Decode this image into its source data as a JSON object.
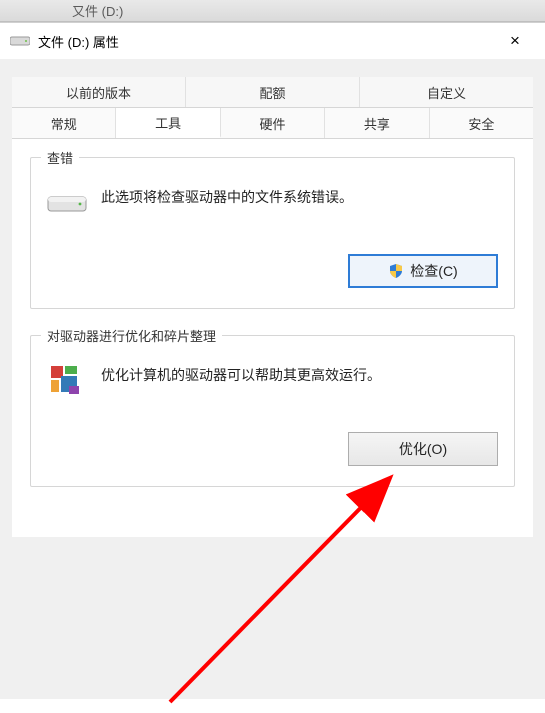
{
  "top_bar": {
    "label": "又件 (D:)"
  },
  "window": {
    "title": "文件 (D:) 属性",
    "close": "×"
  },
  "tabs": {
    "row1": [
      {
        "label": "以前的版本"
      },
      {
        "label": "配额"
      },
      {
        "label": "自定义"
      }
    ],
    "row2": [
      {
        "label": "常规"
      },
      {
        "label": "工具",
        "active": true
      },
      {
        "label": "硬件"
      },
      {
        "label": "共享"
      },
      {
        "label": "安全"
      }
    ]
  },
  "group_check": {
    "title": "查错",
    "desc": "此选项将检查驱动器中的文件系统错误。",
    "button": "检查(C)"
  },
  "group_defrag": {
    "title": "对驱动器进行优化和碎片整理",
    "desc": "优化计算机的驱动器可以帮助其更高效运行。",
    "button": "优化(O)"
  }
}
